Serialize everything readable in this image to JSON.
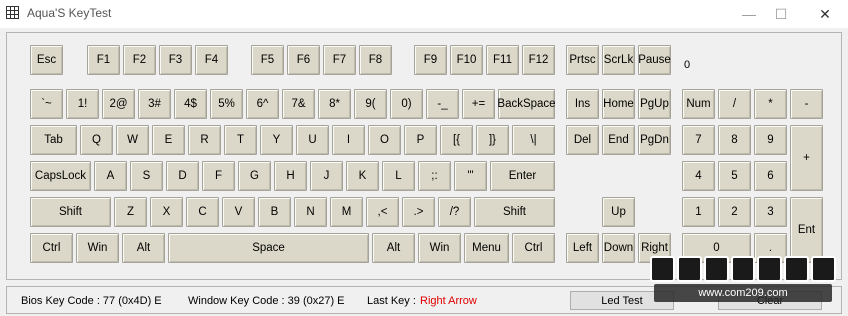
{
  "window": {
    "title": "Aqua'S KeyTest",
    "minimize_glyph": "—",
    "maximize_glyph": "☐",
    "close_glyph": "✕"
  },
  "last_key_code_display": "0",
  "keys": {
    "esc": "Esc",
    "f1": "F1",
    "f2": "F2",
    "f3": "F3",
    "f4": "F4",
    "f5": "F5",
    "f6": "F6",
    "f7": "F7",
    "f8": "F8",
    "f9": "F9",
    "f10": "F10",
    "f11": "F11",
    "f12": "F12",
    "prtsc": "Prtsc",
    "scrlk": "ScrLk",
    "pause": "Pause",
    "backtick": "`~",
    "n1": "1!",
    "n2": "2@",
    "n3": "3#",
    "n4": "4$",
    "n5": "5%",
    "n6": "6^",
    "n7": "7&",
    "n8": "8*",
    "n9": "9(",
    "n0": "0)",
    "minus": "-_",
    "equal": "+=",
    "backspace": "BackSpace",
    "ins": "Ins",
    "home": "Home",
    "pgup": "PgUp",
    "num": "Num",
    "np_div": "/",
    "np_mul": "*",
    "np_sub": "-",
    "tab": "Tab",
    "q": "Q",
    "w": "W",
    "e": "E",
    "r": "R",
    "t": "T",
    "y": "Y",
    "u": "U",
    "i": "I",
    "o": "O",
    "p": "P",
    "lbracket": "[{",
    "rbracket": "]}",
    "backslash": "\\|",
    "del": "Del",
    "end": "End",
    "pgdn": "PgDn",
    "np7": "7",
    "np8": "8",
    "np9": "9",
    "np_add": "+",
    "capslock": "CapsLock",
    "a": "A",
    "s": "S",
    "d": "D",
    "f": "F",
    "g": "G",
    "h": "H",
    "j": "J",
    "k": "K",
    "l": "L",
    "semicolon": ";:",
    "quote": "'\"",
    "enter": "Enter",
    "np4": "4",
    "np5": "5",
    "np6": "6",
    "lshift": "Shift",
    "z": "Z",
    "x": "X",
    "c": "C",
    "v": "V",
    "b": "B",
    "n": "N",
    "m": "M",
    "comma": ",<",
    "period": ".>",
    "slash": "/?",
    "rshift": "Shift",
    "up": "Up",
    "np1": "1",
    "np2": "2",
    "np3": "3",
    "np_enter": "Ent",
    "lctrl": "Ctrl",
    "lwin": "Win",
    "lalt": "Alt",
    "space": "Space",
    "ralt": "Alt",
    "rwin": "Win",
    "menu": "Menu",
    "rctrl": "Ctrl",
    "left": "Left",
    "down": "Down",
    "right": "Right",
    "np0": "0",
    "np_dot": "."
  },
  "status": {
    "bios_key_code": "Bios Key Code : 77 (0x4D) E",
    "window_key_code": "Window Key Code : 39 (0x27) E",
    "last_key_label": "Last Key :",
    "last_key_value": "Right Arrow",
    "led_test_label": "Led Test",
    "clear_label": "Clear"
  },
  "watermark": {
    "url": "www.com209.com"
  }
}
